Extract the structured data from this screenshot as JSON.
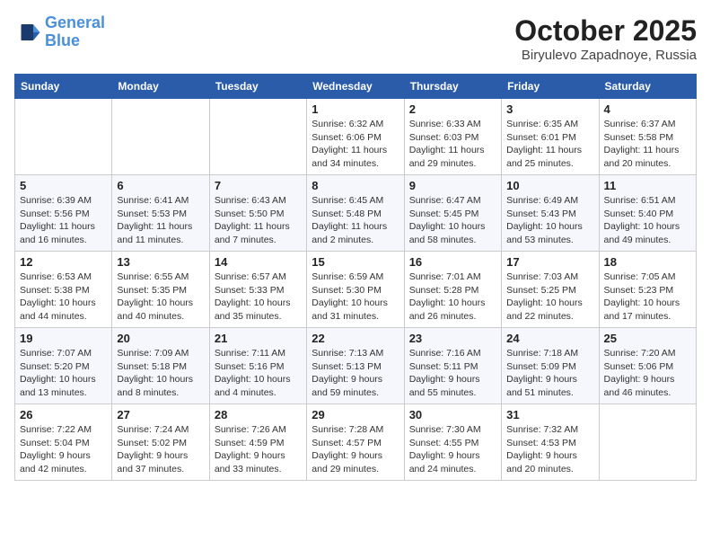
{
  "header": {
    "logo_line1": "General",
    "logo_line2": "Blue",
    "month": "October 2025",
    "location": "Biryulevo Zapadnoye, Russia"
  },
  "weekdays": [
    "Sunday",
    "Monday",
    "Tuesday",
    "Wednesday",
    "Thursday",
    "Friday",
    "Saturday"
  ],
  "weeks": [
    [
      {
        "day": "",
        "info": ""
      },
      {
        "day": "",
        "info": ""
      },
      {
        "day": "",
        "info": ""
      },
      {
        "day": "1",
        "info": "Sunrise: 6:32 AM\nSunset: 6:06 PM\nDaylight: 11 hours\nand 34 minutes."
      },
      {
        "day": "2",
        "info": "Sunrise: 6:33 AM\nSunset: 6:03 PM\nDaylight: 11 hours\nand 29 minutes."
      },
      {
        "day": "3",
        "info": "Sunrise: 6:35 AM\nSunset: 6:01 PM\nDaylight: 11 hours\nand 25 minutes."
      },
      {
        "day": "4",
        "info": "Sunrise: 6:37 AM\nSunset: 5:58 PM\nDaylight: 11 hours\nand 20 minutes."
      }
    ],
    [
      {
        "day": "5",
        "info": "Sunrise: 6:39 AM\nSunset: 5:56 PM\nDaylight: 11 hours\nand 16 minutes."
      },
      {
        "day": "6",
        "info": "Sunrise: 6:41 AM\nSunset: 5:53 PM\nDaylight: 11 hours\nand 11 minutes."
      },
      {
        "day": "7",
        "info": "Sunrise: 6:43 AM\nSunset: 5:50 PM\nDaylight: 11 hours\nand 7 minutes."
      },
      {
        "day": "8",
        "info": "Sunrise: 6:45 AM\nSunset: 5:48 PM\nDaylight: 11 hours\nand 2 minutes."
      },
      {
        "day": "9",
        "info": "Sunrise: 6:47 AM\nSunset: 5:45 PM\nDaylight: 10 hours\nand 58 minutes."
      },
      {
        "day": "10",
        "info": "Sunrise: 6:49 AM\nSunset: 5:43 PM\nDaylight: 10 hours\nand 53 minutes."
      },
      {
        "day": "11",
        "info": "Sunrise: 6:51 AM\nSunset: 5:40 PM\nDaylight: 10 hours\nand 49 minutes."
      }
    ],
    [
      {
        "day": "12",
        "info": "Sunrise: 6:53 AM\nSunset: 5:38 PM\nDaylight: 10 hours\nand 44 minutes."
      },
      {
        "day": "13",
        "info": "Sunrise: 6:55 AM\nSunset: 5:35 PM\nDaylight: 10 hours\nand 40 minutes."
      },
      {
        "day": "14",
        "info": "Sunrise: 6:57 AM\nSunset: 5:33 PM\nDaylight: 10 hours\nand 35 minutes."
      },
      {
        "day": "15",
        "info": "Sunrise: 6:59 AM\nSunset: 5:30 PM\nDaylight: 10 hours\nand 31 minutes."
      },
      {
        "day": "16",
        "info": "Sunrise: 7:01 AM\nSunset: 5:28 PM\nDaylight: 10 hours\nand 26 minutes."
      },
      {
        "day": "17",
        "info": "Sunrise: 7:03 AM\nSunset: 5:25 PM\nDaylight: 10 hours\nand 22 minutes."
      },
      {
        "day": "18",
        "info": "Sunrise: 7:05 AM\nSunset: 5:23 PM\nDaylight: 10 hours\nand 17 minutes."
      }
    ],
    [
      {
        "day": "19",
        "info": "Sunrise: 7:07 AM\nSunset: 5:20 PM\nDaylight: 10 hours\nand 13 minutes."
      },
      {
        "day": "20",
        "info": "Sunrise: 7:09 AM\nSunset: 5:18 PM\nDaylight: 10 hours\nand 8 minutes."
      },
      {
        "day": "21",
        "info": "Sunrise: 7:11 AM\nSunset: 5:16 PM\nDaylight: 10 hours\nand 4 minutes."
      },
      {
        "day": "22",
        "info": "Sunrise: 7:13 AM\nSunset: 5:13 PM\nDaylight: 9 hours\nand 59 minutes."
      },
      {
        "day": "23",
        "info": "Sunrise: 7:16 AM\nSunset: 5:11 PM\nDaylight: 9 hours\nand 55 minutes."
      },
      {
        "day": "24",
        "info": "Sunrise: 7:18 AM\nSunset: 5:09 PM\nDaylight: 9 hours\nand 51 minutes."
      },
      {
        "day": "25",
        "info": "Sunrise: 7:20 AM\nSunset: 5:06 PM\nDaylight: 9 hours\nand 46 minutes."
      }
    ],
    [
      {
        "day": "26",
        "info": "Sunrise: 7:22 AM\nSunset: 5:04 PM\nDaylight: 9 hours\nand 42 minutes."
      },
      {
        "day": "27",
        "info": "Sunrise: 7:24 AM\nSunset: 5:02 PM\nDaylight: 9 hours\nand 37 minutes."
      },
      {
        "day": "28",
        "info": "Sunrise: 7:26 AM\nSunset: 4:59 PM\nDaylight: 9 hours\nand 33 minutes."
      },
      {
        "day": "29",
        "info": "Sunrise: 7:28 AM\nSunset: 4:57 PM\nDaylight: 9 hours\nand 29 minutes."
      },
      {
        "day": "30",
        "info": "Sunrise: 7:30 AM\nSunset: 4:55 PM\nDaylight: 9 hours\nand 24 minutes."
      },
      {
        "day": "31",
        "info": "Sunrise: 7:32 AM\nSunset: 4:53 PM\nDaylight: 9 hours\nand 20 minutes."
      },
      {
        "day": "",
        "info": ""
      }
    ]
  ]
}
